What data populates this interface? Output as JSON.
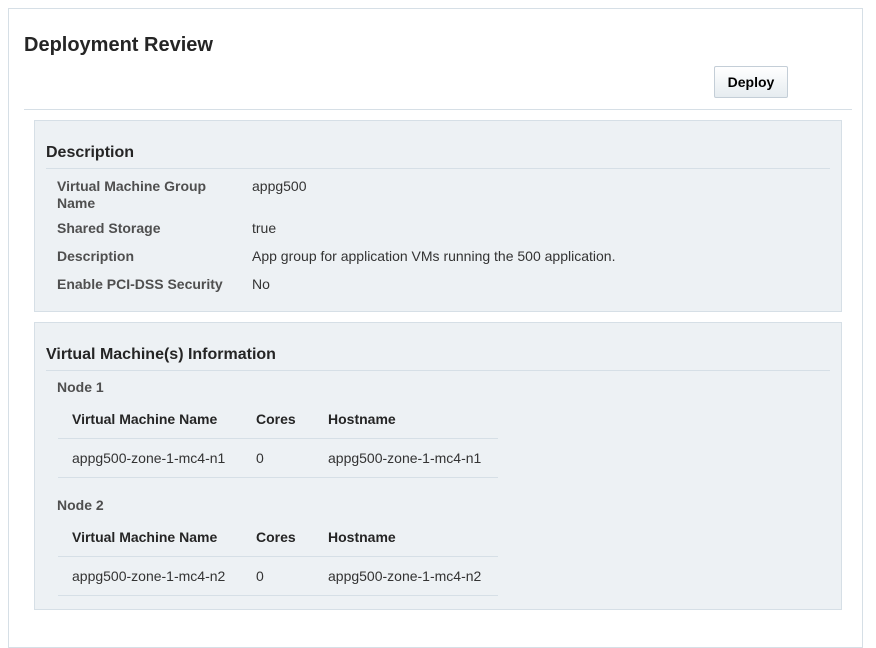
{
  "page": {
    "title": "Deployment Review",
    "deploy_label": "Deploy"
  },
  "description": {
    "title": "Description",
    "fields": [
      {
        "label": "Virtual Machine Group Name",
        "value": "appg500"
      },
      {
        "label": "Shared Storage",
        "value": "true"
      },
      {
        "label": "Description",
        "value": "App group for application VMs running the 500 application."
      },
      {
        "label": "Enable PCI-DSS Security",
        "value": "No"
      }
    ]
  },
  "vm_info": {
    "title": "Virtual Machine(s) Information",
    "columns": [
      "Virtual Machine Name",
      "Cores",
      "Hostname"
    ],
    "nodes": [
      {
        "label": "Node 1",
        "rows": [
          {
            "name": "appg500-zone-1-mc4-n1",
            "cores": "0",
            "hostname": "appg500-zone-1-mc4-n1"
          }
        ]
      },
      {
        "label": "Node 2",
        "rows": [
          {
            "name": "appg500-zone-1-mc4-n2",
            "cores": "0",
            "hostname": "appg500-zone-1-mc4-n2"
          }
        ]
      }
    ]
  }
}
